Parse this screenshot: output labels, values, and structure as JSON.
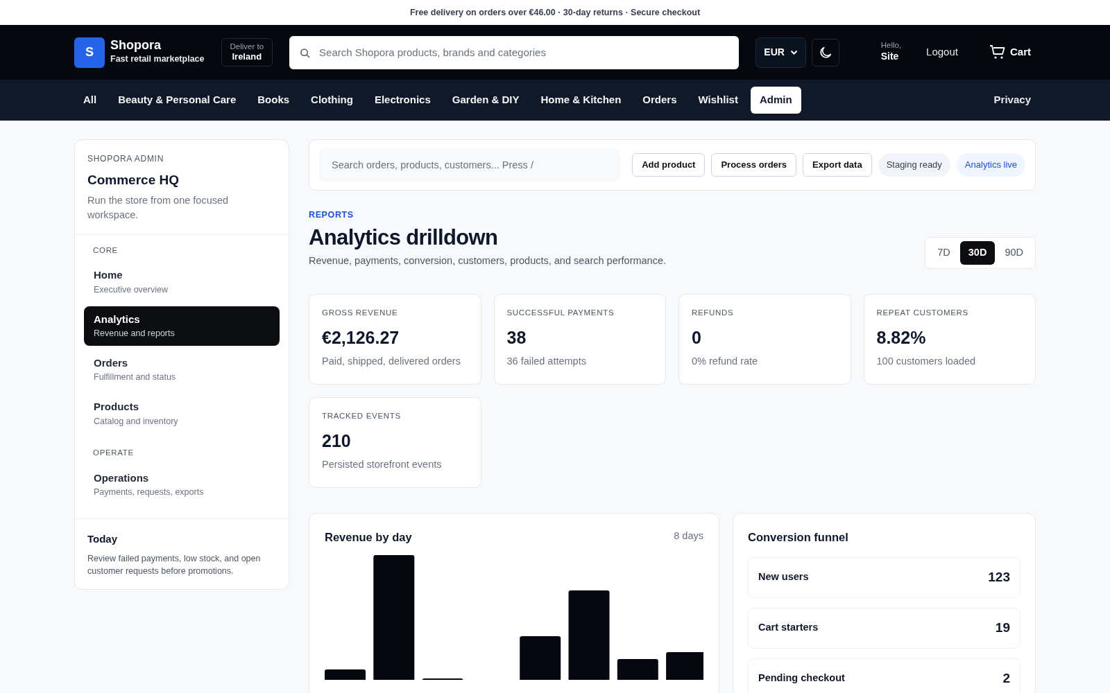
{
  "announcement": "Free delivery on orders over €46.00 · 30-day returns · Secure checkout",
  "header": {
    "logo_letter": "S",
    "brand": "Shopora",
    "tagline": "Fast retail marketplace",
    "deliver_label": "Deliver to",
    "deliver_value": "Ireland",
    "search_placeholder": "Search Shopora products, brands and categories",
    "currency": "EUR",
    "greeting": "Hello,",
    "user": "Site",
    "logout": "Logout",
    "cart": "Cart"
  },
  "nav": {
    "items": [
      {
        "label": "All",
        "selected": false
      },
      {
        "label": "Beauty & Personal Care",
        "selected": false
      },
      {
        "label": "Books",
        "selected": false
      },
      {
        "label": "Clothing",
        "selected": false
      },
      {
        "label": "Electronics",
        "selected": false
      },
      {
        "label": "Garden & DIY",
        "selected": false
      },
      {
        "label": "Home & Kitchen",
        "selected": false
      },
      {
        "label": "Orders",
        "selected": false
      },
      {
        "label": "Wishlist",
        "selected": false
      },
      {
        "label": "Admin",
        "selected": true
      }
    ],
    "right": "Privacy"
  },
  "sidebar": {
    "eyebrow": "SHOPORA ADMIN",
    "title": "Commerce HQ",
    "description": "Run the store from one focused workspace.",
    "sections": [
      {
        "heading": "CORE",
        "items": [
          {
            "title": "Home",
            "subtitle": "Executive overview",
            "selected": false
          },
          {
            "title": "Analytics",
            "subtitle": "Revenue and reports",
            "selected": true
          },
          {
            "title": "Orders",
            "subtitle": "Fulfillment and status",
            "selected": false
          },
          {
            "title": "Products",
            "subtitle": "Catalog and inventory",
            "selected": false
          }
        ]
      },
      {
        "heading": "OPERATE",
        "items": [
          {
            "title": "Operations",
            "subtitle": "Payments, requests, exports",
            "selected": false
          }
        ]
      }
    ],
    "today": {
      "title": "Today",
      "text": "Review failed payments, low stock, and open customer requests before promotions."
    }
  },
  "toolbar": {
    "search_placeholder": "Search orders, products, customers... Press /",
    "buttons": [
      "Add product",
      "Process orders",
      "Export data"
    ],
    "pills": [
      {
        "label": "Staging ready",
        "kind": "neutral"
      },
      {
        "label": "Analytics live",
        "kind": "info"
      }
    ]
  },
  "page": {
    "eyebrow": "REPORTS",
    "title": "Analytics drilldown",
    "subtitle": "Revenue, payments, conversion, customers, products, and search performance.",
    "ranges": [
      {
        "label": "7D",
        "selected": false
      },
      {
        "label": "30D",
        "selected": true
      },
      {
        "label": "90D",
        "selected": false
      }
    ]
  },
  "stats": [
    {
      "label": "GROSS REVENUE",
      "value": "€2,126.27",
      "note": "Paid, shipped, delivered orders"
    },
    {
      "label": "SUCCESSFUL PAYMENTS",
      "value": "38",
      "note": "36 failed attempts"
    },
    {
      "label": "REFUNDS",
      "value": "0",
      "note": "0% refund rate"
    },
    {
      "label": "REPEAT CUSTOMERS",
      "value": "8.82%",
      "note": "100 customers loaded"
    },
    {
      "label": "TRACKED EVENTS",
      "value": "210",
      "note": "Persisted storefront events"
    }
  ],
  "revenue": {
    "title": "Revenue by day",
    "meta": "8 days"
  },
  "funnel": {
    "title": "Conversion funnel",
    "rows": [
      {
        "label": "New users",
        "value": "123"
      },
      {
        "label": "Cart starters",
        "value": "19"
      },
      {
        "label": "Pending checkout",
        "value": "2"
      }
    ]
  }
}
